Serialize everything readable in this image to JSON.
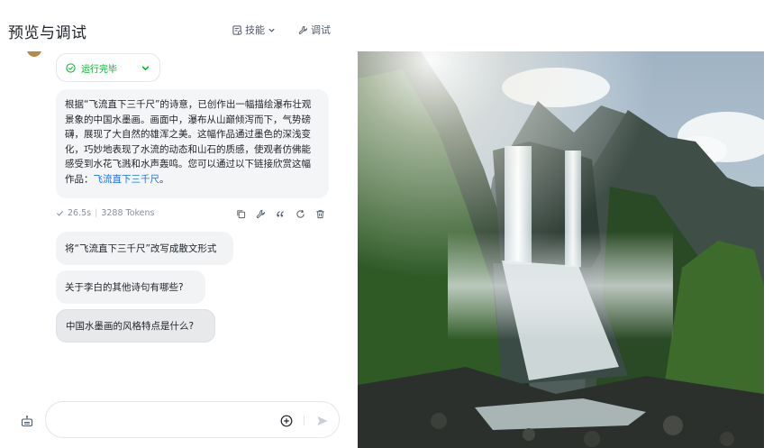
{
  "header": {
    "title": "预览与调试",
    "skills_label": "技能",
    "debug_label": "调试"
  },
  "chat": {
    "status_label": "运行完毕",
    "response_text": "根据“飞流直下三千尺”的诗意，已创作出一幅描绘瀑布壮观景象的中国水墨画。画面中，瀑布从山巅倾泻而下，气势磅礴，展现了大自然的雄浑之美。这幅作品通过墨色的深浅变化，巧妙地表现了水流的动态和山石的质感，使观者仿佛能感受到水花飞溅和水声轰鸣。您可以通过以下链接欣赏这幅作品：",
    "response_link": "飞流直下三千尺",
    "response_end": "。",
    "meta_time": "26.5s",
    "meta_tokens": "3288 Tokens",
    "suggestions": [
      "将“飞流直下三千尺”改写成散文形式",
      "关于李白的其他诗句有哪些?",
      "中国水墨画的风格特点是什么?"
    ]
  },
  "input": {
    "value": "",
    "placeholder": ""
  },
  "colors": {
    "success": "#00b42a",
    "link": "#1e6fff",
    "bubble_bg": "#f4f5f7",
    "muted": "#86909c"
  }
}
